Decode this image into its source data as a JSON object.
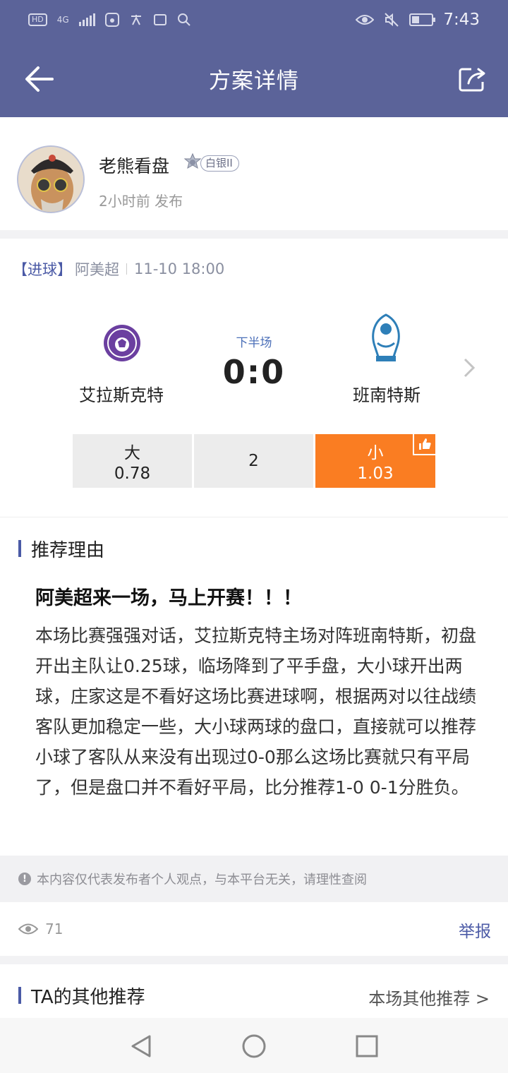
{
  "status_bar": {
    "left_chips": [
      "HD",
      "4G"
    ],
    "time": "7:43"
  },
  "header": {
    "title": "方案详情",
    "back_icon": "arrow-left-icon",
    "share_icon": "share-icon"
  },
  "author": {
    "name": "老熊看盘",
    "level": "白银II",
    "published": "2小时前 发布"
  },
  "match": {
    "tag": "【进球】",
    "league": "阿美超",
    "kickoff": "11-10  18:00",
    "home_team": "艾拉斯克特",
    "away_team": "班南特斯",
    "period": "下半场",
    "score": "0:0"
  },
  "odds": {
    "over_label": "大",
    "over_value": "0.78",
    "line": "2",
    "under_label": "小",
    "under_value": "1.03",
    "selected": "under",
    "accent_color": "#fa7d22"
  },
  "recommendation": {
    "section_title": "推荐理由",
    "headline": "阿美超来一场，马上开赛！！！",
    "body": "本场比赛强强对话，艾拉斯克特主场对阵班南特斯，初盘开出主队让0.25球，临场降到了平手盘，大小球开出两球，庄家这是不看好这场比赛进球啊，根据两对以往战绩客队更加稳定一些，大小球两球的盘口，直接就可以推荐小球了客队从来没有出现过0-0那么这场比赛就只有平局了，但是盘口并不看好平局，比分推荐1-0 0-1分胜负。"
  },
  "disclaimer": "本内容仅代表发布者个人观点，与本平台无关，请理性查阅",
  "stats": {
    "views": "71",
    "report_label": "举报"
  },
  "others": {
    "title": "TA的其他推荐",
    "more_label": "本场其他推荐 >"
  },
  "colors": {
    "brand": "#5b6399",
    "accent": "#fa7d22",
    "link": "#4b5aa6"
  }
}
